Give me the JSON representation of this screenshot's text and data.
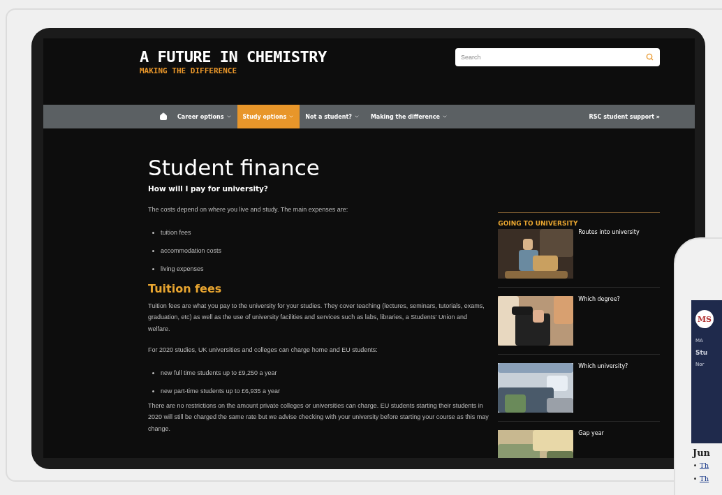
{
  "site": {
    "logo_title": "A FUTURE IN CHEMISTRY",
    "logo_tagline": "MAKING THE DIFFERENCE",
    "search": {
      "placeholder": "Search"
    }
  },
  "nav": {
    "items": [
      {
        "label": "Career options",
        "selected": false
      },
      {
        "label": "Study options",
        "selected": true
      },
      {
        "label": "Not a student?",
        "selected": false
      },
      {
        "label": "Making the difference",
        "selected": false
      }
    ],
    "support_link": "RSC student support »"
  },
  "article": {
    "title": "Student finance",
    "subtitle": "How will I pay for university?",
    "blocks": [
      {
        "kind": "paragraph",
        "text": "The costs depend on where you live and study. The main expenses are:"
      },
      {
        "kind": "list",
        "items": [
          "tuition fees",
          "accommodation costs",
          "living expenses"
        ]
      },
      {
        "kind": "heading",
        "text": "Tuition fees"
      },
      {
        "kind": "paragraph",
        "text": "Tuition fees are what you pay to the university for your studies. They cover teaching (lectures, seminars, tutorials, exams, graduation, etc) as well as the use of university facilities and services such as labs, libraries, a Students' Union and welfare."
      },
      {
        "kind": "paragraph",
        "text": "For 2020 studies, UK universities and colleges can charge home and EU students:"
      },
      {
        "kind": "list",
        "items": [
          "new full time students up to £9,250 a year",
          "new part-time students up to £6,935 a year"
        ]
      },
      {
        "kind": "paragraph",
        "text": "There are no restrictions on the amount private colleges or universities can charge. EU students starting their students in 2020 will still be charged the same rate but we advise checking with your university before starting your course as this may change."
      }
    ]
  },
  "sidebar": {
    "title": "GOING TO UNIVERSITY",
    "items": [
      {
        "label": "Routes into university"
      },
      {
        "label": "Which degree?"
      },
      {
        "label": "Which university?"
      },
      {
        "label": "Gap year"
      }
    ]
  },
  "phone": {
    "logo": "MS",
    "lines": [
      "MA",
      "Stu",
      "Nor"
    ],
    "heading": "Jun",
    "links": [
      "Th",
      "Th"
    ]
  }
}
